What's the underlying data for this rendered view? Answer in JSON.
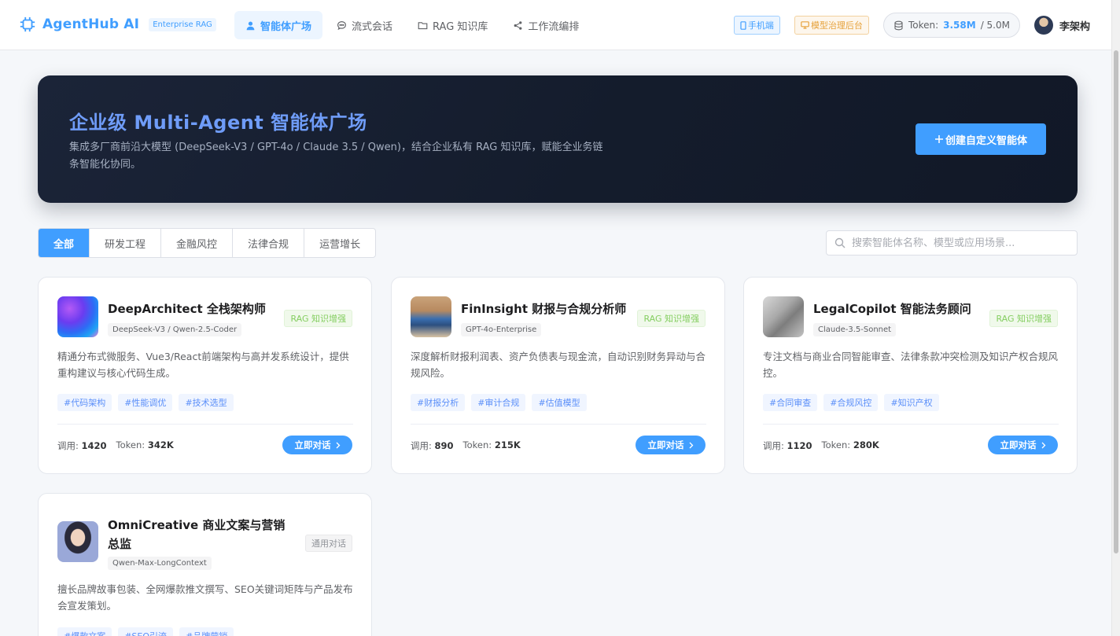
{
  "header": {
    "brand": "AgentHub AI",
    "brand_badge": "Enterprise RAG",
    "nav": [
      {
        "label": "智能体广场",
        "icon": "user-icon",
        "active": true
      },
      {
        "label": "流式会话",
        "icon": "chat-bubble-icon",
        "active": false
      },
      {
        "label": "RAG 知识库",
        "icon": "folder-icon",
        "active": false
      },
      {
        "label": "工作流编排",
        "icon": "share-nodes-icon",
        "active": false
      }
    ],
    "mobile_btn": "手机端",
    "admin_btn": "模型治理后台",
    "token_label": "Token:",
    "token_used": "3.58M",
    "token_total": "/ 5.0M",
    "user_name": "李架构"
  },
  "hero": {
    "title": "企业级 Multi-Agent 智能体广场",
    "subtitle": "集成多厂商前沿大模型 (DeepSeek-V3 / GPT-4o / Claude 3.5 / Qwen)，结合企业私有 RAG 知识库，赋能全业务链条智能化协同。",
    "create_btn": "创建自定义智能体"
  },
  "filters": [
    "全部",
    "研发工程",
    "金融风控",
    "法律合规",
    "运营增长"
  ],
  "search": {
    "placeholder": "搜索智能体名称、模型或应用场景..."
  },
  "colors": {
    "accent": "#409eff",
    "hero_bg": "#141c2c",
    "rag_tag": "#85ce61",
    "admin_orange": "#e6a23c"
  },
  "cards": [
    {
      "name": "DeepArchitect 全栈架构师",
      "model": "DeepSeek-V3 / Qwen-2.5-Coder",
      "type": "RAG 知识增强",
      "desc": "精通分布式微服务、Vue3/React前端架构与高并发系统设计，提供重构建议与核心代码生成。",
      "tags": [
        "#代码架构",
        "#性能调优",
        "#技术选型"
      ],
      "calls_label": "调用:",
      "calls": "1420",
      "token_label": "Token:",
      "tokens": "342K",
      "btn": "立即对话"
    },
    {
      "name": "FinInsight 财报与合规分析师",
      "model": "GPT-4o-Enterprise",
      "type": "RAG 知识增强",
      "desc": "深度解析财报利润表、资产负债表与现金流，自动识别财务异动与合规风险。",
      "tags": [
        "#财报分析",
        "#审计合规",
        "#估值模型"
      ],
      "calls_label": "调用:",
      "calls": "890",
      "token_label": "Token:",
      "tokens": "215K",
      "btn": "立即对话"
    },
    {
      "name": "LegalCopilot 智能法务顾问",
      "model": "Claude-3.5-Sonnet",
      "type": "RAG 知识增强",
      "desc": "专注文档与商业合同智能审查、法律条款冲突检测及知识产权合规风控。",
      "tags": [
        "#合同审查",
        "#合规风控",
        "#知识产权"
      ],
      "calls_label": "调用:",
      "calls": "1120",
      "token_label": "Token:",
      "tokens": "280K",
      "btn": "立即对话"
    },
    {
      "name": "OmniCreative 商业文案与营销总监",
      "model": "Qwen-Max-LongContext",
      "type": "通用对话",
      "desc": "擅长品牌故事包装、全网爆款推文撰写、SEO关键词矩阵与产品发布会宣发策划。",
      "tags": [
        "#爆款文案",
        "#SEO引流",
        "#品牌营销"
      ]
    }
  ]
}
